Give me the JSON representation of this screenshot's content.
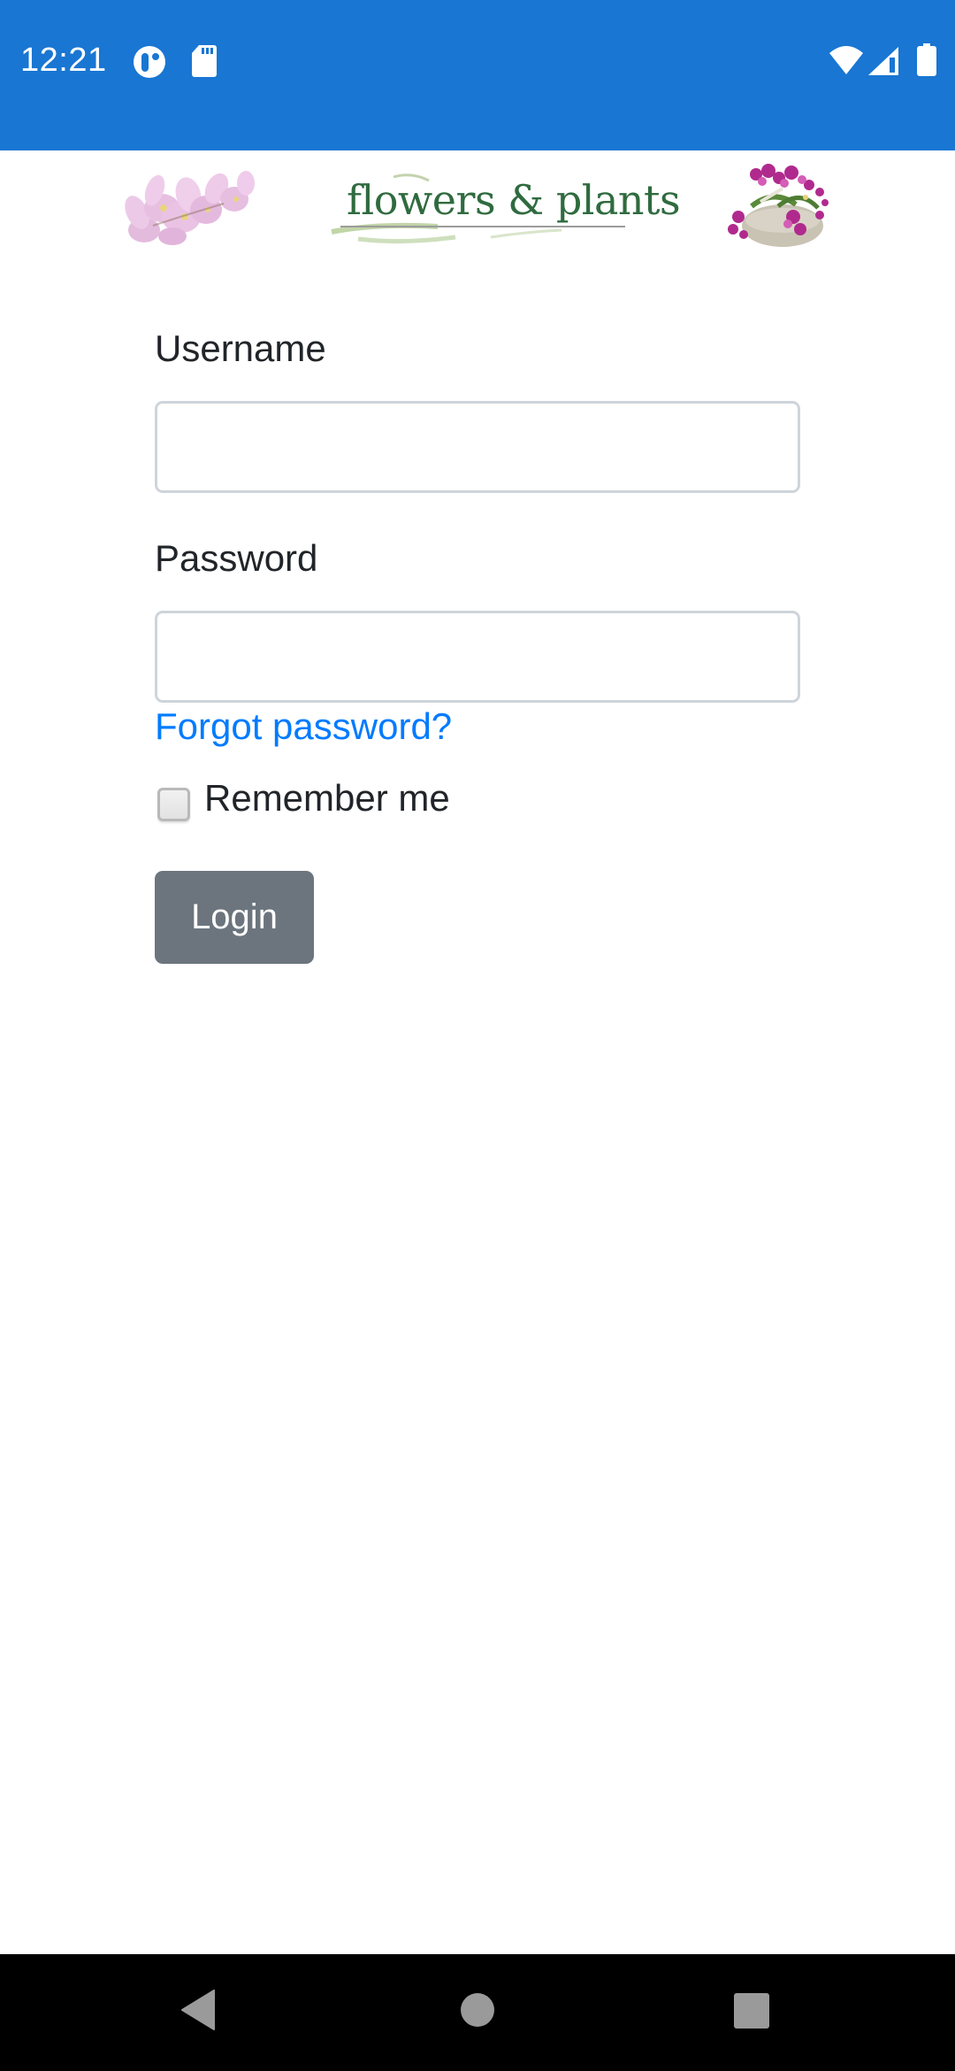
{
  "status_bar": {
    "time": "12:21",
    "left_icons": [
      "assistant-icon",
      "sd-card-icon"
    ],
    "right_icons": [
      "wifi-icon",
      "cellular-signal-icon",
      "battery-icon"
    ],
    "background_color": "#1976D2"
  },
  "header": {
    "logo_text": "flowers & plants",
    "left_image": "pink-orchids-image",
    "right_image": "potted-orchid-image",
    "logo_color": "#2f6b3f"
  },
  "form": {
    "username": {
      "label": "Username",
      "value": "",
      "placeholder": ""
    },
    "password": {
      "label": "Password",
      "value": "",
      "placeholder": ""
    },
    "forgot_password_label": "Forgot password?",
    "remember_me": {
      "label": "Remember me",
      "checked": false
    },
    "login_label": "Login",
    "link_color": "#007bff",
    "button_color": "#6c757d"
  },
  "nav_bar": {
    "buttons": [
      "back",
      "home",
      "recents"
    ]
  }
}
